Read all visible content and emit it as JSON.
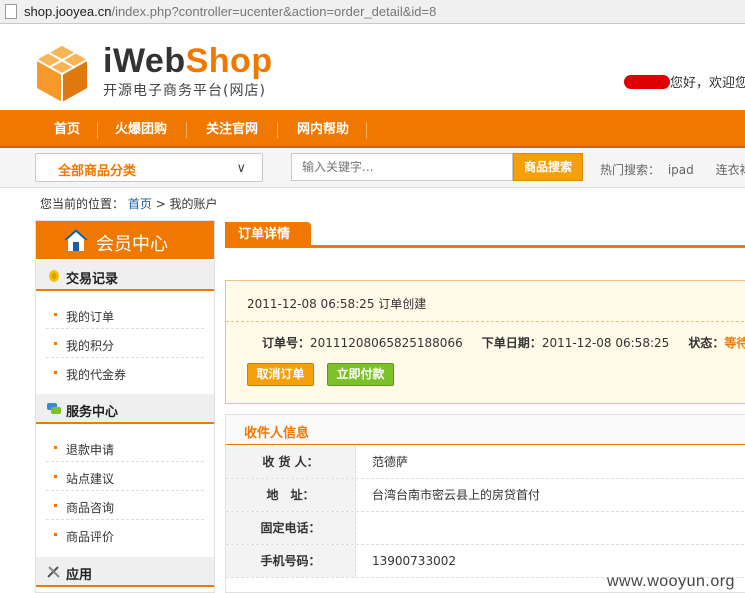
{
  "browser": {
    "url_host": "shop.jooyea.cn",
    "url_path": "/index.php?controller=ucenter&action=order_detail&id=8"
  },
  "header": {
    "brand_prefix": "iWeb",
    "brand_suffix": "Shop",
    "slogan": "开源电子商务平台(网店)",
    "welcome": "您好，欢迎您来"
  },
  "nav": {
    "items": [
      "首页",
      "火爆团购",
      "关注官网",
      "网内帮助"
    ]
  },
  "search": {
    "category_label": "全部商品分类",
    "placeholder": "输入关键字...",
    "button": "商品搜索",
    "hot_label": "热门搜索：",
    "hot_keywords": [
      "ipad",
      "连衣裙"
    ]
  },
  "breadcrumb": {
    "prefix": "您当前的位置：",
    "home": "首页",
    "current": "> 我的账户"
  },
  "sidebar": {
    "title": "会员中心",
    "groups": [
      {
        "title": "交易记录",
        "items": [
          "我的订单",
          "我的积分",
          "我的代金券"
        ]
      },
      {
        "title": "服务中心",
        "items": [
          "退款申请",
          "站点建议",
          "商品咨询",
          "商品评价"
        ]
      },
      {
        "title": "应用",
        "items": []
      }
    ]
  },
  "main": {
    "tab": "订单详情",
    "order": {
      "created_time": "2011-12-08 06:58:25",
      "created_text": "订单创建",
      "order_no_label": "订单号：",
      "order_no": "20111208065825188066",
      "date_label": "下单日期：",
      "date": "2011-12-08 06:58:25",
      "status_label": "状态：",
      "status": "等待付款",
      "cancel_button": "取消订单",
      "pay_button": "立即付款"
    },
    "receiver": {
      "title": "收件人信息",
      "rows": [
        {
          "label": "收 货 人：",
          "value": "范德萨"
        },
        {
          "label": "地　址：",
          "value": "台湾台南市密云县上的房贷首付"
        },
        {
          "label": "固定电话：",
          "value": ""
        },
        {
          "label": "手机号码：",
          "value": "13900733002"
        }
      ]
    }
  },
  "watermark": "www.wooyun.org",
  "colors": {
    "accent": "#f07800",
    "pay_green": "#7cc02a",
    "link": "#1a5fa0"
  }
}
